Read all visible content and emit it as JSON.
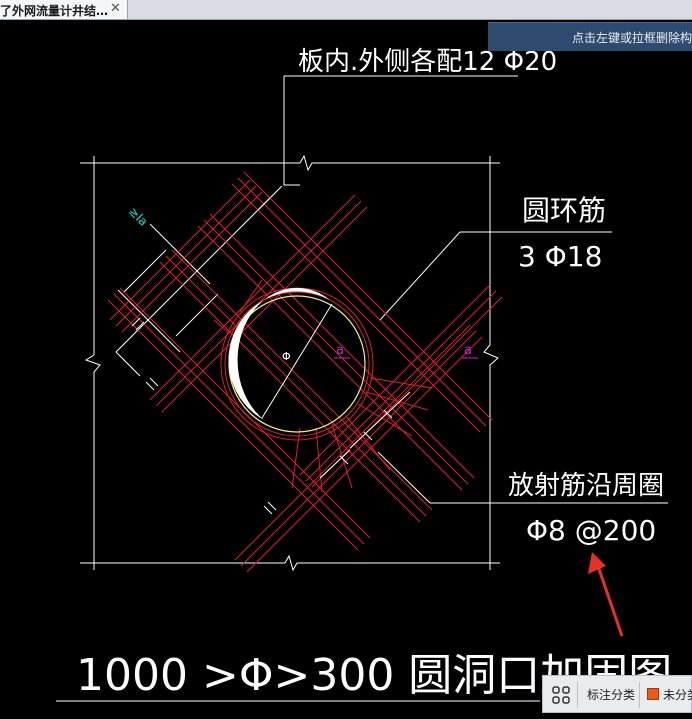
{
  "tab": {
    "title": "了外网流量计井结…",
    "close": "✕"
  },
  "hint": {
    "text": "点击左键或拉框删除构"
  },
  "drawing": {
    "label_outer": "板内.外侧各配12 Φ20",
    "label_ring": "圆环筋",
    "label_ring_spec": "3 Φ18",
    "label_radial": "放射筋沿周圈",
    "label_radial_spec": "Φ8 @200",
    "title": "1000 >Φ>300 圆洞口加固图",
    "dim_la": "≥la",
    "mark_a1": "a",
    "mark_a2": "a",
    "mark_phi": "Φ"
  },
  "bottombar": {
    "label": "标注分类",
    "label2": "未分类",
    "swatch_color": "#e8591a"
  },
  "colors": {
    "background": "#000000",
    "rebar": "#e0202a",
    "leader": "#ffffff",
    "dimension": "#00e5e5",
    "marker": "#d020d0",
    "arrow": "#e8302a"
  }
}
